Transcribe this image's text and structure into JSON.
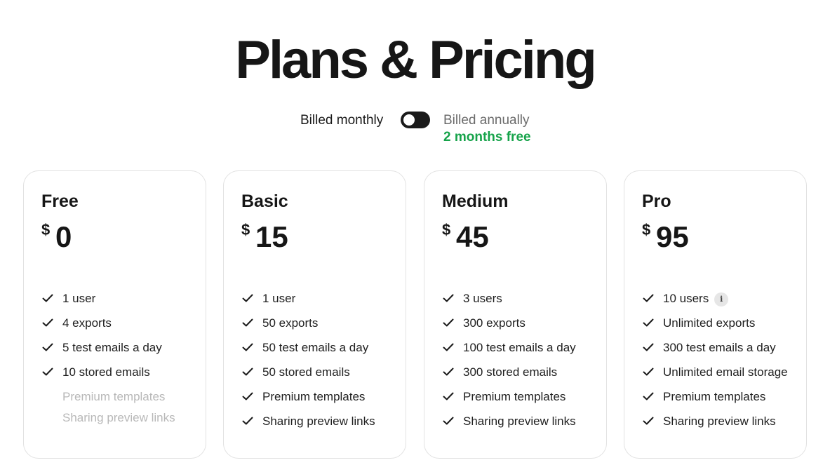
{
  "page": {
    "title": "Plans & Pricing"
  },
  "billing": {
    "monthly_label": "Billed monthly",
    "annually_label": "Billed annually",
    "annual_note": "2 months free",
    "toggle_on": false
  },
  "colors": {
    "accent_green": "#16a34a",
    "text_dark": "#161616",
    "toggle_bg": "#1a1a1a",
    "disabled_text": "#b8b8b8"
  },
  "plans": [
    {
      "name": "Free",
      "currency": "$",
      "price": "0",
      "features": [
        {
          "label": "1 user",
          "included": true
        },
        {
          "label": "4 exports",
          "included": true
        },
        {
          "label": "5 test emails a day",
          "included": true
        },
        {
          "label": "10 stored emails",
          "included": true
        },
        {
          "label": "Premium templates",
          "included": false
        },
        {
          "label": "Sharing preview links",
          "included": false
        }
      ]
    },
    {
      "name": "Basic",
      "currency": "$",
      "price": "15",
      "features": [
        {
          "label": "1 user",
          "included": true
        },
        {
          "label": "50 exports",
          "included": true
        },
        {
          "label": "50 test emails a day",
          "included": true
        },
        {
          "label": "50 stored emails",
          "included": true
        },
        {
          "label": "Premium templates",
          "included": true
        },
        {
          "label": "Sharing preview links",
          "included": true
        }
      ]
    },
    {
      "name": "Medium",
      "currency": "$",
      "price": "45",
      "features": [
        {
          "label": "3 users",
          "included": true
        },
        {
          "label": "300 exports",
          "included": true
        },
        {
          "label": "100 test emails a day",
          "included": true
        },
        {
          "label": "300 stored emails",
          "included": true
        },
        {
          "label": "Premium templates",
          "included": true
        },
        {
          "label": "Sharing preview links",
          "included": true
        }
      ]
    },
    {
      "name": "Pro",
      "currency": "$",
      "price": "95",
      "features": [
        {
          "label": "10 users",
          "included": true,
          "info_icon": "info-icon"
        },
        {
          "label": "Unlimited exports",
          "included": true
        },
        {
          "label": "300 test emails a day",
          "included": true
        },
        {
          "label": "Unlimited email storage",
          "included": true
        },
        {
          "label": "Premium templates",
          "included": true
        },
        {
          "label": "Sharing preview links",
          "included": true
        }
      ]
    }
  ]
}
